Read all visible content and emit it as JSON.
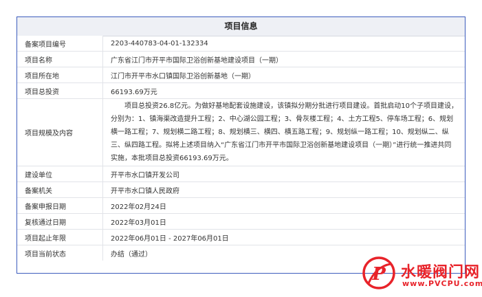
{
  "table_title": "项目信息",
  "rows": [
    {
      "label": "备案项目编号",
      "value": "2203-440783-04-01-132334"
    },
    {
      "label": "项目名称",
      "value": "广东省江门市开平市国际卫浴创新基地建设项目（一期）"
    },
    {
      "label": "项目所在地",
      "value": "江门市开平市水口镇国际卫浴创新基地（一期）"
    },
    {
      "label": "项目总投资",
      "value": "66193.69万元"
    },
    {
      "label": "项目规模及内容",
      "value": "项目总投资26.8亿元。为做好基地配套设施建设，该镇拟分期分批进行项目建设。首批启动10个子项目建设，分别为：1、镇海渠改造提升工程；2、中心湖公园工程；3、骨灰楼工程；4、土方工程5、停车场工程；6、规划横一路工程；7、规划横二路工程；8、规划横三、横四、横五路工程；9、规划纵一路工程；10、规划纵二、纵三、纵四路工程。拟将上述项目纳入“广东省江门市开平市国际卫浴创新基地建设项目（一期）”进行统一推进共同实施，本批项目总投资66193.69万元。"
    },
    {
      "label": "建设单位",
      "value": "开平市水口镇开发公司"
    },
    {
      "label": "备案机关",
      "value": "开平市水口镇人民政府"
    },
    {
      "label": "备案申报日期",
      "value": "2022年02月24日"
    },
    {
      "label": "复核通过日期",
      "value": "2022年03月01日"
    },
    {
      "label": "项目起止年限",
      "value": "2022年06月01日 - 2027年06月01日"
    },
    {
      "label": "项目当前状态",
      "value": "办结（通过）"
    }
  ],
  "watermark": {
    "logo_text": "P",
    "cn": "水暖阀门网",
    "en": "www.PVCPU.com",
    "color": "#e8232a"
  }
}
